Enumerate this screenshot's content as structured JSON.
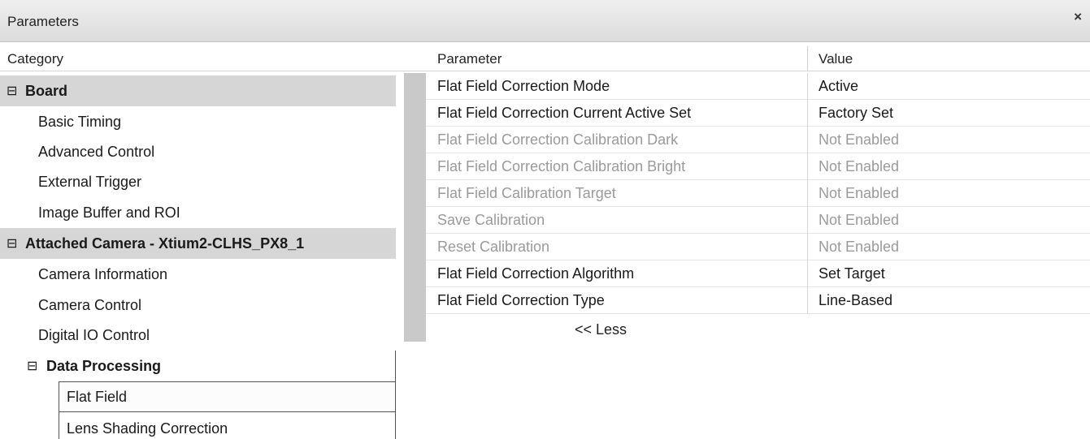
{
  "window": {
    "title": "Parameters",
    "close_glyph": "×"
  },
  "columns": {
    "category": "Category",
    "parameter": "Parameter",
    "value": "Value"
  },
  "categories": {
    "expand_glyph": "⊟",
    "board": {
      "label": "Board",
      "items": [
        "Basic Timing",
        "Advanced Control",
        "External Trigger",
        "Image Buffer and ROI"
      ]
    },
    "camera": {
      "label": "Attached Camera - Xtium2-CLHS_PX8_1",
      "items": [
        "Camera Information",
        "Camera Control",
        "Digital IO Control"
      ]
    },
    "data_processing": {
      "label": "Data Processing",
      "items": [
        "Flat Field",
        "Lens Shading Correction"
      ],
      "selected": "Flat Field"
    }
  },
  "parameters": [
    {
      "name": "Flat Field Correction Mode",
      "value": "Active",
      "enabled": true
    },
    {
      "name": "Flat Field Correction Current Active Set",
      "value": "Factory Set",
      "enabled": true
    },
    {
      "name": "Flat Field Correction Calibration Dark",
      "value": "Not Enabled",
      "enabled": false
    },
    {
      "name": "Flat Field Correction Calibration Bright",
      "value": "Not Enabled",
      "enabled": false
    },
    {
      "name": "Flat Field Calibration Target",
      "value": "Not Enabled",
      "enabled": false
    },
    {
      "name": "Save Calibration",
      "value": "Not Enabled",
      "enabled": false
    },
    {
      "name": "Reset Calibration",
      "value": "Not Enabled",
      "enabled": false
    },
    {
      "name": "Flat Field Correction Algorithm",
      "value": "Set Target",
      "enabled": true
    },
    {
      "name": "Flat Field Correction Type",
      "value": "Line-Based",
      "enabled": true
    }
  ],
  "less_link": "<< Less"
}
